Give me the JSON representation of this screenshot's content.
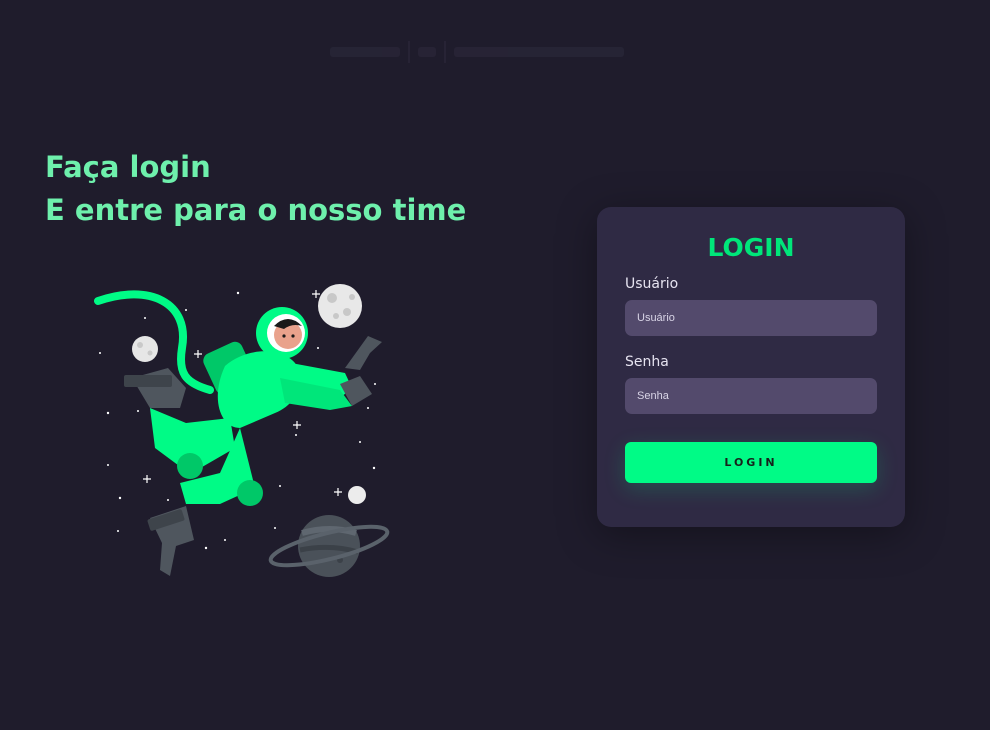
{
  "headline": {
    "line1": "Faça login",
    "line2": "E entre para o nosso time"
  },
  "illustration": {
    "icon": "astronaut-in-space-illustration",
    "accent_color": "#00fb86"
  },
  "login_card": {
    "title": "LOGIN",
    "username": {
      "label": "Usuário",
      "placeholder": "Usuário",
      "value": ""
    },
    "password": {
      "label": "Senha",
      "placeholder": "Senha",
      "value": ""
    },
    "submit_label": "LOGIN"
  },
  "colors": {
    "background": "#1f1c2c",
    "card": "#2f2a44",
    "input": "#534a6c",
    "accent": "#00fb86",
    "headline": "#6ef0ac"
  }
}
